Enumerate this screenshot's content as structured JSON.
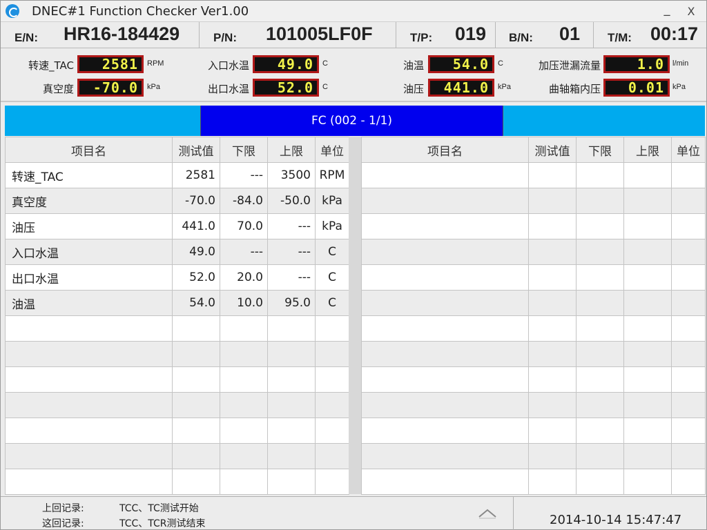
{
  "window": {
    "title": "DNEC#1 Function Checker Ver1.00",
    "minimize_label": "_",
    "close_label": "X"
  },
  "info": {
    "en_label": "E/N:",
    "en_value": "HR16-184429",
    "pn_label": "P/N:",
    "pn_value": "101005LF0F",
    "tp_label": "T/P:",
    "tp_value": "019",
    "bn_label": "B/N:",
    "bn_value": "01",
    "tm_label": "T/M:",
    "tm_value": "00:17"
  },
  "gauges": [
    {
      "label": "转速_TAC",
      "value": "2581",
      "unit": "RPM"
    },
    {
      "label": "入口水温",
      "value": "49.0",
      "unit": "C"
    },
    {
      "label": "油温",
      "value": "54.0",
      "unit": "C"
    },
    {
      "label": "加压泄漏流量",
      "value": "1.0",
      "unit": "l/min"
    },
    {
      "label": "真空度",
      "value": "-70.0",
      "unit": "kPa"
    },
    {
      "label": "出口水温",
      "value": "52.0",
      "unit": "C"
    },
    {
      "label": "油压",
      "value": "441.0",
      "unit": "kPa"
    },
    {
      "label": "曲轴箱内压",
      "value": "0.01",
      "unit": "kPa"
    }
  ],
  "banner": {
    "text": "FC (002 - 1/1)"
  },
  "table": {
    "headers": [
      "项目名",
      "测试值",
      "下限",
      "上限",
      "单位"
    ],
    "rows": [
      {
        "name": "转速_TAC",
        "value": "2581",
        "lower": "---",
        "upper": "3500",
        "unit": "RPM"
      },
      {
        "name": "真空度",
        "value": "-70.0",
        "lower": "-84.0",
        "upper": "-50.0",
        "unit": "kPa"
      },
      {
        "name": "油压",
        "value": "441.0",
        "lower": "70.0",
        "upper": "---",
        "unit": "kPa"
      },
      {
        "name": "入口水温",
        "value": "49.0",
        "lower": "---",
        "upper": "---",
        "unit": "C"
      },
      {
        "name": "出口水温",
        "value": "52.0",
        "lower": "20.0",
        "upper": "---",
        "unit": "C"
      },
      {
        "name": "油温",
        "value": "54.0",
        "lower": "10.0",
        "upper": "95.0",
        "unit": "C"
      }
    ],
    "total_rows": 13
  },
  "footer": {
    "last_record_label": "上回记录:",
    "last_record_value": "TCC、TC测试开始",
    "this_record_label": "这回记录:",
    "this_record_value": "TCC、TCR测试结束",
    "datetime": "2014-10-14 15:47:47"
  },
  "colors": {
    "banner_side": "#00aaee",
    "banner_center": "#0000ee",
    "display_bg": "#111111",
    "display_border": "#b01818",
    "display_text": "#f2f24a"
  }
}
